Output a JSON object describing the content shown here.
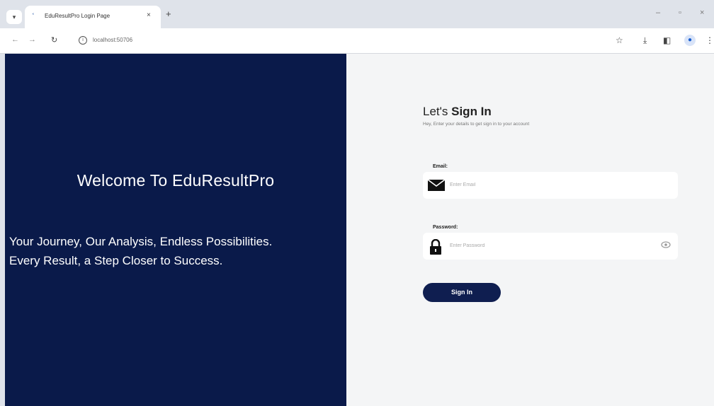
{
  "browser": {
    "tab_title": "EduResultPro Login Page",
    "url": "localhost:50706",
    "tab_close": "×",
    "new_tab": "+"
  },
  "hero": {
    "title": "Welcome To EduResultPro",
    "tagline_line1": "Your Journey, Our Analysis, Endless Possibilities.",
    "tagline_line2": "Every Result, a Step Closer to Success."
  },
  "signin": {
    "heading_prefix": "Let's",
    "heading_bold": "Sign In",
    "subtitle": "Hey, Enter your details to get sign in to your account",
    "email_label": "Email:",
    "email_placeholder": "Enter Email",
    "password_label": "Password:",
    "password_placeholder": "Enter Password",
    "button_label": "Sign In"
  },
  "colors": {
    "left_panel": "#0a1a4a",
    "button": "#0f1e50",
    "right_panel": "#f4f5f6"
  },
  "icons": {
    "email": "envelope-icon",
    "password": "lock-icon",
    "show_password": "eye-icon"
  }
}
